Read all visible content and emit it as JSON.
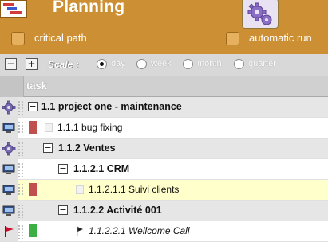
{
  "header": {
    "title": "Planning",
    "run_icon": "gears-icon",
    "app_icon": "gantt-chart-icon",
    "critical_path_label": "critical path",
    "automatic_run_label": "automatic run",
    "bg_color": "#cc8f33"
  },
  "toolbar": {
    "collapse_glyph": "−",
    "expand_glyph": "+",
    "scale_label": "Scale :",
    "scale_options": [
      "day",
      "week",
      "month",
      "quarter"
    ],
    "selected_scale": "day"
  },
  "grid": {
    "column_header": "task",
    "rows": [
      {
        "name": "1.1 project one - maintenance",
        "kind": "project",
        "icon": "gear-icon",
        "toggle": "−",
        "status_color": "",
        "bold": true,
        "italic": false,
        "highlight": false
      },
      {
        "name": "1.1.1 bug fixing",
        "kind": "task",
        "icon": "computer-icon",
        "toggle": "",
        "status_color": "#c0504d",
        "bold": false,
        "italic": false,
        "highlight": false
      },
      {
        "name": "1.1.2 Ventes",
        "kind": "project",
        "icon": "gear-icon",
        "toggle": "−",
        "status_color": "",
        "bold": true,
        "italic": false,
        "highlight": false
      },
      {
        "name": "1.1.2.1 CRM",
        "kind": "group",
        "icon": "computer-icon",
        "toggle": "−",
        "status_color": "",
        "bold": true,
        "italic": false,
        "highlight": false
      },
      {
        "name": "1.1.2.1.1 Suivi clients",
        "kind": "task",
        "icon": "computer-icon",
        "toggle": "",
        "status_color": "#c0504d",
        "bold": false,
        "italic": false,
        "highlight": true
      },
      {
        "name": "1.1.2.2 Activité 001",
        "kind": "group",
        "icon": "computer-icon",
        "toggle": "−",
        "status_color": "",
        "bold": true,
        "italic": false,
        "highlight": false
      },
      {
        "name": "1.1.2.2.1 Wellcome Call",
        "kind": "milestone",
        "icon": "flag-icon",
        "toggle": "",
        "status_color": "#3cb043",
        "bold": false,
        "italic": true,
        "highlight": false
      }
    ]
  }
}
